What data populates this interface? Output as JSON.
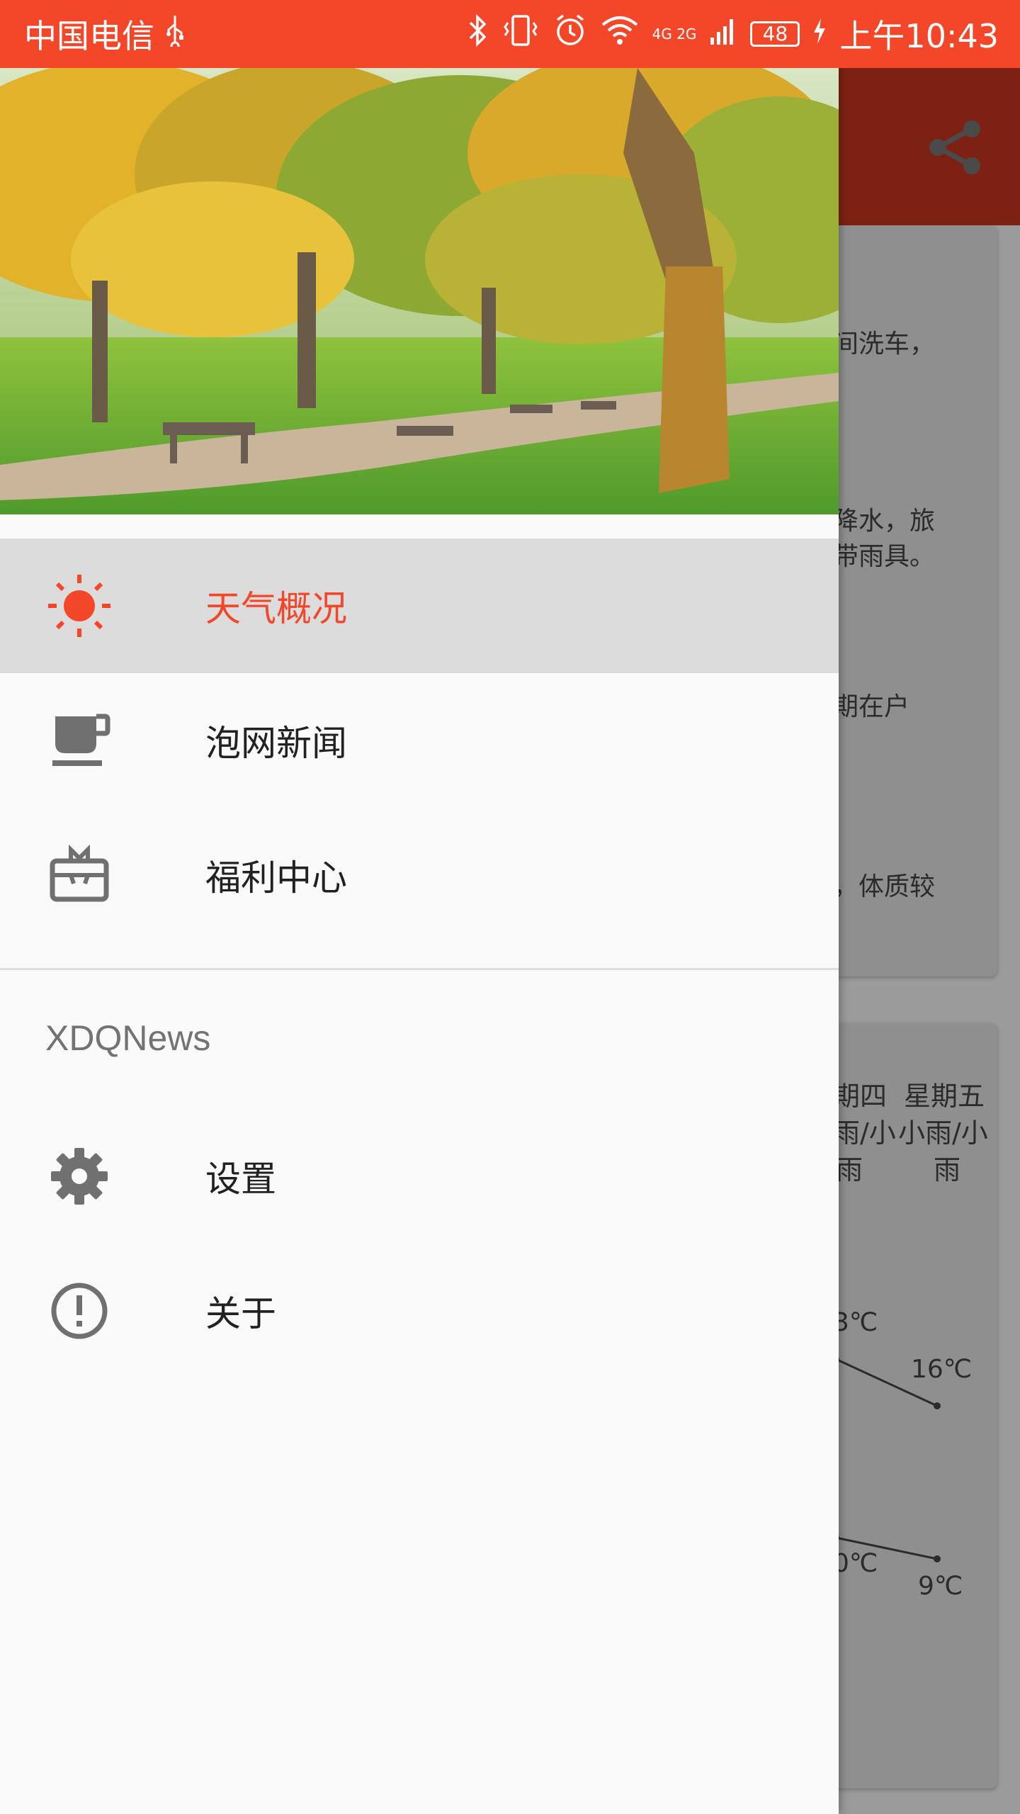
{
  "status_bar": {
    "carrier": "中国电信",
    "network_label": "4G 2G",
    "battery": "48",
    "time": "上午10:43"
  },
  "background_screen": {
    "snippets": [
      "间洗车，",
      "降水，旅",
      "带雨具。",
      "期在户",
      "，体质较"
    ],
    "forecast_days": [
      "期四",
      "星期五"
    ],
    "forecast_weather": [
      "雨/小",
      "小雨/小",
      "雨",
      "雨"
    ],
    "temps": [
      "3℃",
      "16℃",
      "0℃",
      "9℃"
    ]
  },
  "drawer": {
    "header_image": "park-autumn-trees-painting",
    "menu": [
      {
        "label": "天气概况",
        "icon": "sun-icon",
        "active": true
      },
      {
        "label": "泡网新闻",
        "icon": "coffee-cup-icon",
        "active": false
      },
      {
        "label": "福利中心",
        "icon": "gift-card-icon",
        "active": false
      }
    ],
    "section_title": "XDQNews",
    "section_items": [
      {
        "label": "设置",
        "icon": "gear-icon"
      },
      {
        "label": "关于",
        "icon": "info-alert-icon"
      }
    ]
  },
  "colors": {
    "accent": "#F4472A",
    "toolbar_dimmed": "#7D2212",
    "active_bg": "#DCDCDC",
    "icon_gray": "#707070"
  }
}
